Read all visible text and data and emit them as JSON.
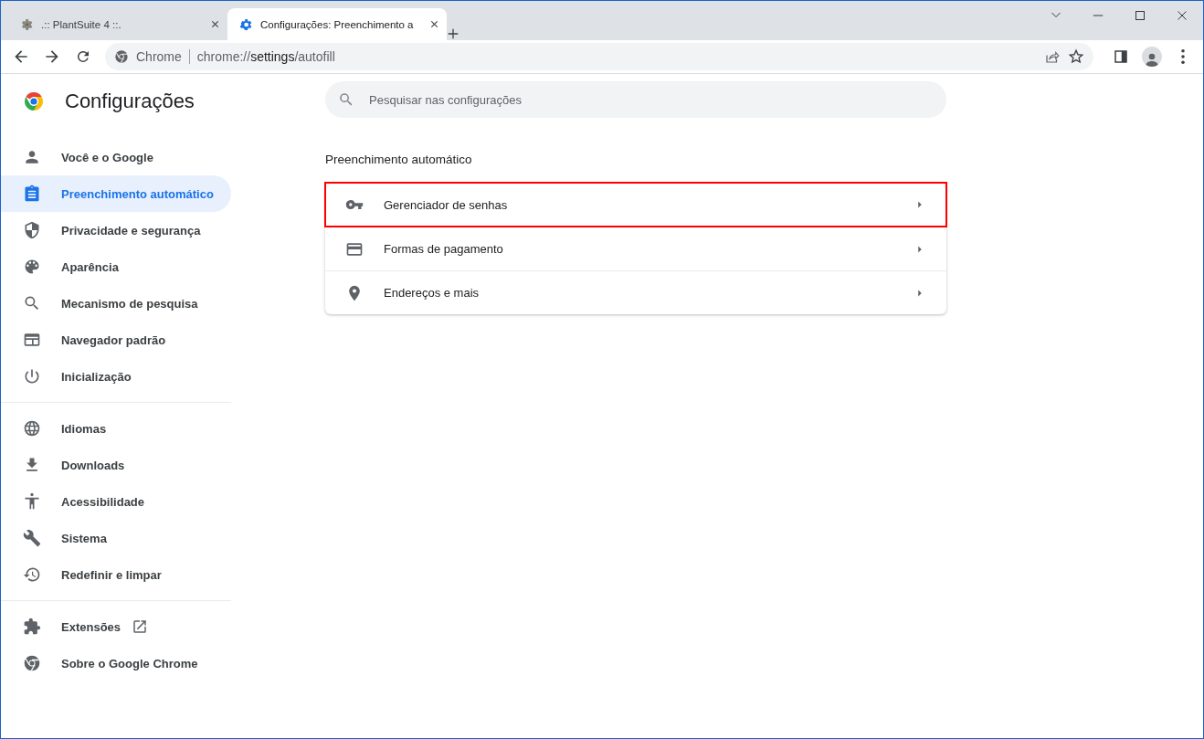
{
  "tabs": [
    {
      "title": ".:: PlantSuite 4 ::.",
      "selected": false
    },
    {
      "title": "Configurações: Preenchimento a",
      "selected": true
    }
  ],
  "address_bar": {
    "site_label": "Chrome",
    "url": {
      "scheme": "chrome://",
      "host": "settings",
      "path": "/autofill"
    }
  },
  "page_title": "Configurações",
  "search": {
    "placeholder": "Pesquisar nas configurações"
  },
  "sidebar": {
    "groups": [
      [
        {
          "label": "Você e o Google",
          "selected": false
        },
        {
          "label": "Preenchimento automático",
          "selected": true
        },
        {
          "label": "Privacidade e segurança",
          "selected": false
        },
        {
          "label": "Aparência",
          "selected": false
        },
        {
          "label": "Mecanismo de pesquisa",
          "selected": false
        },
        {
          "label": "Navegador padrão",
          "selected": false
        },
        {
          "label": "Inicialização",
          "selected": false
        }
      ],
      [
        {
          "label": "Idiomas",
          "selected": false
        },
        {
          "label": "Downloads",
          "selected": false
        },
        {
          "label": "Acessibilidade",
          "selected": false
        },
        {
          "label": "Sistema",
          "selected": false
        },
        {
          "label": "Redefinir e limpar",
          "selected": false
        }
      ],
      [
        {
          "label": "Extensões",
          "selected": false
        },
        {
          "label": "Sobre o Google Chrome",
          "selected": false
        }
      ]
    ]
  },
  "section": {
    "title": "Preenchimento automático",
    "items": [
      {
        "label": "Gerenciador de senhas",
        "highlighted": true
      },
      {
        "label": "Formas de pagamento",
        "highlighted": false
      },
      {
        "label": "Endereços e mais",
        "highlighted": false
      }
    ]
  }
}
